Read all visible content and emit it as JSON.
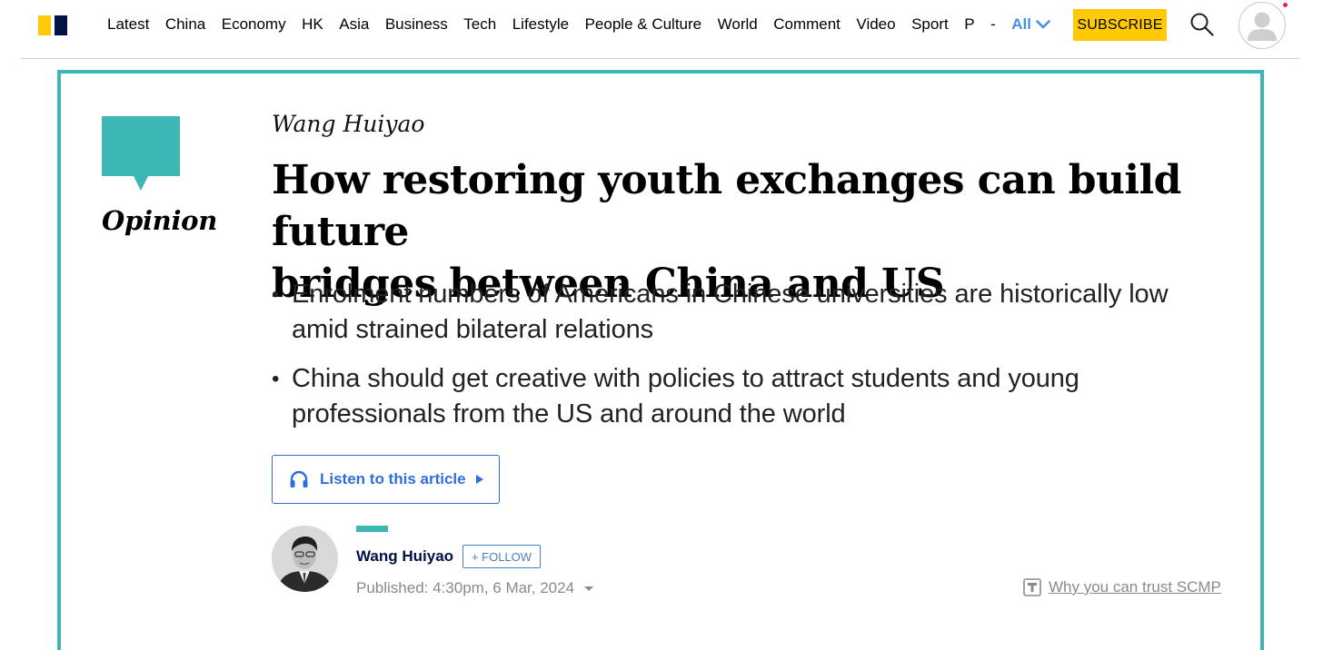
{
  "nav": {
    "items": [
      "Latest",
      "China",
      "Economy",
      "HK",
      "Asia",
      "Business",
      "Tech",
      "Lifestyle",
      "People & Culture",
      "World",
      "Comment",
      "Video",
      "Sport",
      "P"
    ],
    "separator": "-",
    "all_label": "All",
    "subscribe_label": "SUBSCRIBE"
  },
  "colors": {
    "brand_yellow": "#FFCA05",
    "brand_navy": "#001246",
    "opinion_teal": "#3CB7B5",
    "link_blue": "#2F6FDB"
  },
  "article": {
    "section_label": "Opinion",
    "author_top": "Wang Huiyao",
    "headline_line1": "How restoring youth exchanges can build future",
    "headline_line2": "bridges between China and US",
    "summary": [
      {
        "line1": "Enrolment numbers of Americans in Chinese universities are historically low",
        "line2": "amid strained bilateral relations"
      },
      {
        "line1": "China should get creative with policies to attract students and young",
        "line2": "professionals from the US and around the world"
      }
    ],
    "listen_label": "Listen to this article",
    "byline": {
      "name": "Wang Huiyao",
      "follow_label": "+ FOLLOW",
      "published": "Published: 4:30pm, 6 Mar, 2024"
    },
    "trust_label": "Why you can trust SCMP"
  }
}
